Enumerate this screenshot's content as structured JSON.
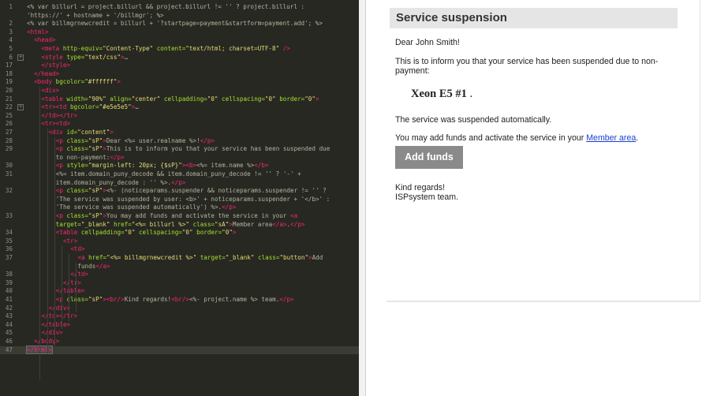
{
  "editor": {
    "lines": [
      {
        "n": "1",
        "fold": false,
        "indent": 0,
        "parts": [
          [
            "tpl",
            "<% var billurl = project.billurl && project.billurl != '' ? project.billurl :"
          ]
        ]
      },
      {
        "n": "",
        "fold": false,
        "indent": 0,
        "parts": [
          [
            "tpl",
            "'https://' + hostname + '/billmgr'; %>"
          ]
        ]
      },
      {
        "n": "2",
        "fold": false,
        "indent": 0,
        "parts": [
          [
            "tpl",
            "<% var billmgrnewcredit = billurl + '?startpage=payment&startform=payment.add'; %>"
          ]
        ]
      },
      {
        "n": "3",
        "fold": false,
        "indent": 0,
        "parts": [
          [
            "tag",
            "<html>"
          ]
        ]
      },
      {
        "n": "4",
        "fold": false,
        "indent": 1,
        "parts": [
          [
            "tag",
            "<head>"
          ]
        ]
      },
      {
        "n": "5",
        "fold": false,
        "indent": 2,
        "parts": [
          [
            "tag",
            "<meta "
          ],
          [
            "attr",
            "http-equiv="
          ],
          [
            "str",
            "\"Content-Type\" "
          ],
          [
            "attr",
            "content="
          ],
          [
            "str",
            "\"text/html; charset=UTF-8\" "
          ],
          [
            "tag",
            "/>"
          ]
        ]
      },
      {
        "n": "6",
        "fold": true,
        "indent": 2,
        "parts": [
          [
            "tag",
            "<style "
          ],
          [
            "attr",
            "type="
          ],
          [
            "str",
            "\"text/css\""
          ],
          [
            "tag",
            ">"
          ],
          [
            "tpl",
            "…"
          ]
        ]
      },
      {
        "n": "17",
        "fold": false,
        "indent": 2,
        "parts": [
          [
            "tag",
            "</style>"
          ]
        ]
      },
      {
        "n": "18",
        "fold": false,
        "indent": 1,
        "parts": [
          [
            "tag",
            "</head>"
          ]
        ]
      },
      {
        "n": "19",
        "fold": false,
        "indent": 1,
        "parts": [
          [
            "tag",
            "<body "
          ],
          [
            "attr",
            "bgcolor="
          ],
          [
            "str",
            "\"#ffffff\""
          ],
          [
            "tag",
            ">"
          ]
        ]
      },
      {
        "n": "20",
        "fold": false,
        "indent": 2,
        "parts": [
          [
            "tag",
            "<div>"
          ]
        ]
      },
      {
        "n": "21",
        "fold": false,
        "indent": 2,
        "parts": [
          [
            "tag",
            "<table "
          ],
          [
            "attr",
            "width="
          ],
          [
            "str",
            "\"90%\" "
          ],
          [
            "attr",
            "align="
          ],
          [
            "str",
            "\"center\" "
          ],
          [
            "attr",
            "cellpadding="
          ],
          [
            "str",
            "\"0\" "
          ],
          [
            "attr",
            "cellspacing="
          ],
          [
            "str",
            "\"0\" "
          ],
          [
            "attr",
            "border="
          ],
          [
            "str",
            "\"0\""
          ],
          [
            "tag",
            ">"
          ]
        ]
      },
      {
        "n": "22",
        "fold": true,
        "indent": 2,
        "parts": [
          [
            "tag",
            "<tr><td "
          ],
          [
            "attr",
            "bgcolor="
          ],
          [
            "str",
            "\"#e5e5e5\""
          ],
          [
            "tag",
            ">"
          ],
          [
            "tpl",
            "…"
          ]
        ]
      },
      {
        "n": "25",
        "fold": false,
        "indent": 2,
        "parts": [
          [
            "tag",
            "</td></tr>"
          ]
        ]
      },
      {
        "n": "26",
        "fold": false,
        "indent": 2,
        "parts": [
          [
            "tag",
            "<tr><td>"
          ]
        ]
      },
      {
        "n": "27",
        "fold": false,
        "indent": 3,
        "parts": [
          [
            "tag",
            "<div "
          ],
          [
            "attr",
            "id="
          ],
          [
            "str",
            "\"content\""
          ],
          [
            "tag",
            ">"
          ]
        ]
      },
      {
        "n": "28",
        "fold": false,
        "indent": 4,
        "parts": [
          [
            "tag",
            "<p "
          ],
          [
            "attr",
            "class="
          ],
          [
            "str",
            "\"sP\""
          ],
          [
            "tag",
            ">"
          ],
          [
            "tpl",
            "Dear <%= user.realname %>!"
          ],
          [
            "tag",
            "</p>"
          ]
        ]
      },
      {
        "n": "29",
        "fold": false,
        "indent": 4,
        "parts": [
          [
            "tag",
            "<p "
          ],
          [
            "attr",
            "class="
          ],
          [
            "str",
            "\"sP\""
          ],
          [
            "tag",
            ">"
          ],
          [
            "tpl",
            "This is to inform you that your service has been suspended due"
          ]
        ]
      },
      {
        "n": "",
        "fold": false,
        "indent": 4,
        "parts": [
          [
            "tpl",
            "to non-payment:"
          ],
          [
            "tag",
            "</p>"
          ]
        ]
      },
      {
        "n": "30",
        "fold": false,
        "indent": 4,
        "parts": [
          [
            "tag",
            "<p "
          ],
          [
            "attr",
            "style="
          ],
          [
            "str",
            "\"margin-left: 20px; {$sP}\""
          ],
          [
            "tag",
            "><b>"
          ],
          [
            "tpl",
            "<%= item.name %>"
          ],
          [
            "tag",
            "</b>"
          ]
        ]
      },
      {
        "n": "31",
        "fold": false,
        "indent": 4,
        "parts": [
          [
            "tpl",
            "<%= item.domain_puny_decode && item.domain_puny_decode != '' ? '-' +"
          ]
        ]
      },
      {
        "n": "",
        "fold": false,
        "indent": 4,
        "parts": [
          [
            "tpl",
            "item.domain_puny_decode : '' %>."
          ],
          [
            "tag",
            "</p>"
          ]
        ]
      },
      {
        "n": "32",
        "fold": false,
        "indent": 4,
        "parts": [
          [
            "tag",
            "<p "
          ],
          [
            "attr",
            "class="
          ],
          [
            "str",
            "\"sP\""
          ],
          [
            "tag",
            ">"
          ],
          [
            "tpl",
            "<%- (noticeparams.suspender && noticeparams.suspender != '' ?"
          ]
        ]
      },
      {
        "n": "",
        "fold": false,
        "indent": 4,
        "parts": [
          [
            "tpl",
            "'The service was suspended by user: <b>' + noticeparams.suspender + '</b>' :"
          ]
        ]
      },
      {
        "n": "",
        "fold": false,
        "indent": 4,
        "parts": [
          [
            "tpl",
            "'The service was suspended automatically') %>."
          ],
          [
            "tag",
            "</p>"
          ]
        ]
      },
      {
        "n": "33",
        "fold": false,
        "indent": 4,
        "parts": [
          [
            "tag",
            "<p "
          ],
          [
            "attr",
            "class="
          ],
          [
            "str",
            "\"sP\""
          ],
          [
            "tag",
            ">"
          ],
          [
            "tpl",
            "You may add funds and activate the service in your "
          ],
          [
            "tag",
            "<a"
          ]
        ]
      },
      {
        "n": "",
        "fold": false,
        "indent": 4,
        "parts": [
          [
            "attr",
            "target="
          ],
          [
            "str",
            "\"_blank\" "
          ],
          [
            "attr",
            "href="
          ],
          [
            "str",
            "\"<%= billurl %>\" "
          ],
          [
            "attr",
            "class="
          ],
          [
            "str",
            "\"sA\""
          ],
          [
            "tag",
            ">"
          ],
          [
            "tpl",
            "Member area"
          ],
          [
            "tag",
            "</a>"
          ],
          [
            "tpl",
            "."
          ],
          [
            "tag",
            "</p>"
          ]
        ]
      },
      {
        "n": "34",
        "fold": false,
        "indent": 4,
        "parts": [
          [
            "tag",
            "<table "
          ],
          [
            "attr",
            "cellpadding="
          ],
          [
            "str",
            "\"0\" "
          ],
          [
            "attr",
            "cellspacing="
          ],
          [
            "str",
            "\"0\" "
          ],
          [
            "attr",
            "border="
          ],
          [
            "str",
            "\"0\""
          ],
          [
            "tag",
            ">"
          ]
        ]
      },
      {
        "n": "35",
        "fold": false,
        "indent": 5,
        "parts": [
          [
            "tag",
            "<tr>"
          ]
        ]
      },
      {
        "n": "36",
        "fold": false,
        "indent": 6,
        "parts": [
          [
            "tag",
            "<td>"
          ]
        ]
      },
      {
        "n": "37",
        "fold": false,
        "indent": 7,
        "parts": [
          [
            "tag",
            "<a "
          ],
          [
            "attr",
            "href="
          ],
          [
            "str",
            "\"<%= billmgrnewcredit %>\" "
          ],
          [
            "attr",
            "target="
          ],
          [
            "str",
            "\"_blank\" "
          ],
          [
            "attr",
            "class="
          ],
          [
            "str",
            "\"button\""
          ],
          [
            "tag",
            ">"
          ],
          [
            "tpl",
            "Add"
          ]
        ]
      },
      {
        "n": "",
        "fold": false,
        "indent": 7,
        "parts": [
          [
            "tpl",
            "funds"
          ],
          [
            "tag",
            "</a>"
          ]
        ]
      },
      {
        "n": "38",
        "fold": false,
        "indent": 6,
        "parts": [
          [
            "tag",
            "</td>"
          ]
        ]
      },
      {
        "n": "39",
        "fold": false,
        "indent": 5,
        "parts": [
          [
            "tag",
            "</tr>"
          ]
        ]
      },
      {
        "n": "40",
        "fold": false,
        "indent": 4,
        "parts": [
          [
            "tag",
            "</table>"
          ]
        ]
      },
      {
        "n": "41",
        "fold": false,
        "indent": 4,
        "parts": [
          [
            "tag",
            "<p "
          ],
          [
            "attr",
            "class="
          ],
          [
            "str",
            "\"sP\""
          ],
          [
            "tag",
            "><br/>"
          ],
          [
            "tpl",
            "Kind regards!"
          ],
          [
            "tag",
            "<br/>"
          ],
          [
            "tpl",
            "<%- project.name %> team."
          ],
          [
            "tag",
            "</p>"
          ]
        ]
      },
      {
        "n": "42",
        "fold": false,
        "indent": 3,
        "parts": [
          [
            "tag",
            "</div>"
          ]
        ]
      },
      {
        "n": "43",
        "fold": false,
        "indent": 2,
        "parts": [
          [
            "tag",
            "</td></tr>"
          ]
        ]
      },
      {
        "n": "44",
        "fold": false,
        "indent": 2,
        "parts": [
          [
            "tag",
            "</table>"
          ]
        ]
      },
      {
        "n": "45",
        "fold": false,
        "indent": 2,
        "parts": [
          [
            "tag",
            "</div>"
          ]
        ]
      },
      {
        "n": "46",
        "fold": false,
        "indent": 1,
        "parts": [
          [
            "tag",
            "</body>"
          ]
        ]
      },
      {
        "n": "47",
        "fold": false,
        "indent": 0,
        "active": true,
        "parts": [
          [
            "hl",
            "</html>"
          ]
        ]
      }
    ]
  },
  "email": {
    "header_title": "Service suspension",
    "greeting": "Dear John Smith!",
    "info": "This is to inform you that your service has been suspended due to non-payment:",
    "item_name": "Xeon E5 #1",
    "item_suffix": " .",
    "suspended_text": "The service was suspended automatically.",
    "add_funds_prefix": "You may add funds and activate the service in your ",
    "member_area_link": "Member area",
    "add_funds_suffix": ".",
    "button_label": "Add funds",
    "regards_line1": "Kind regards!",
    "regards_line2": "ISPsystem team.",
    "link_color": "#1a3fd0",
    "button_color": "#8a8a8a"
  }
}
